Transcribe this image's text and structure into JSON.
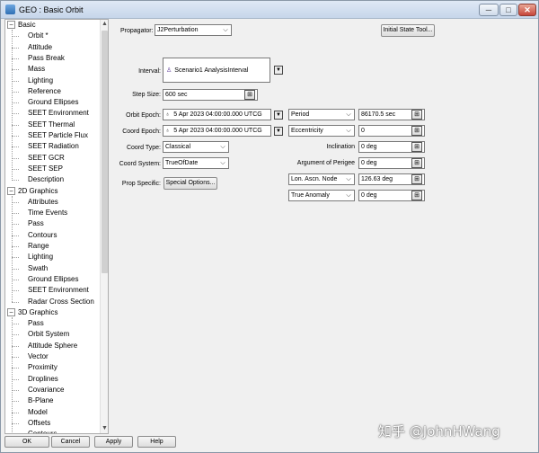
{
  "window": {
    "title": "GEO : Basic Orbit",
    "buttons": {
      "minimize": "─",
      "maximize": "□",
      "close": "✕"
    }
  },
  "tree": {
    "groups": [
      {
        "label": "Basic",
        "items": [
          "Orbit *",
          "Attitude",
          "Pass Break",
          "Mass",
          "Lighting",
          "Reference",
          "Ground Ellipses",
          "SEET Environment",
          "SEET Thermal",
          "SEET Particle Flux",
          "SEET Radiation",
          "SEET GCR",
          "SEET SEP",
          "Description"
        ]
      },
      {
        "label": "2D Graphics",
        "items": [
          "Attributes",
          "Time Events",
          "Pass",
          "Contours",
          "Range",
          "Lighting",
          "Swath",
          "Ground Ellipses",
          "SEET Environment",
          "Radar Cross Section"
        ]
      },
      {
        "label": "3D Graphics",
        "items": [
          "Pass",
          "Orbit System",
          "Attitude Sphere",
          "Vector",
          "Proximity",
          "Droplines",
          "Covariance",
          "B-Plane",
          "Model",
          "Offsets",
          "Contours"
        ]
      }
    ],
    "toggle_symbol": "−",
    "scroll_up": "▲",
    "scroll_down": "▼"
  },
  "propagator": {
    "label": "Propagator:",
    "value": "J2Perturbation",
    "initial_state_button": "Initial State Tool..."
  },
  "interval": {
    "label": "Interval:",
    "value": "Scenario1 AnalysisInterval"
  },
  "step_size": {
    "label": "Step Size:",
    "value": "600 sec"
  },
  "orbit_epoch": {
    "label": "Orbit Epoch:",
    "value": "5 Apr 2023 04:00:00.000 UTCG"
  },
  "coord_epoch": {
    "label": "Coord Epoch:",
    "value": "5 Apr 2023 04:00:00.000 UTCG"
  },
  "coord_type": {
    "label": "Coord Type:",
    "value": "Classical"
  },
  "coord_system": {
    "label": "Coord System:",
    "value": "TrueOfDate"
  },
  "prop_specific": {
    "label": "Prop Specific:",
    "button": "Special Options..."
  },
  "elements": [
    {
      "kind": "combo",
      "label": "Period",
      "value": "86170.5 sec"
    },
    {
      "kind": "combo",
      "label": "Eccentricity",
      "value": "0"
    },
    {
      "kind": "text",
      "label": "Inclination",
      "value": "0 deg"
    },
    {
      "kind": "text",
      "label": "Argument of Perigee",
      "value": "0 deg"
    },
    {
      "kind": "combo",
      "label": "Lon. Ascn. Node",
      "value": "126.63 deg"
    },
    {
      "kind": "combo",
      "label": "True Anomaly",
      "value": "0 deg"
    }
  ],
  "footer": {
    "ok": "OK",
    "cancel": "Cancel",
    "apply": "Apply",
    "help": "Help"
  },
  "watermark": "知乎 @JohnHWang"
}
